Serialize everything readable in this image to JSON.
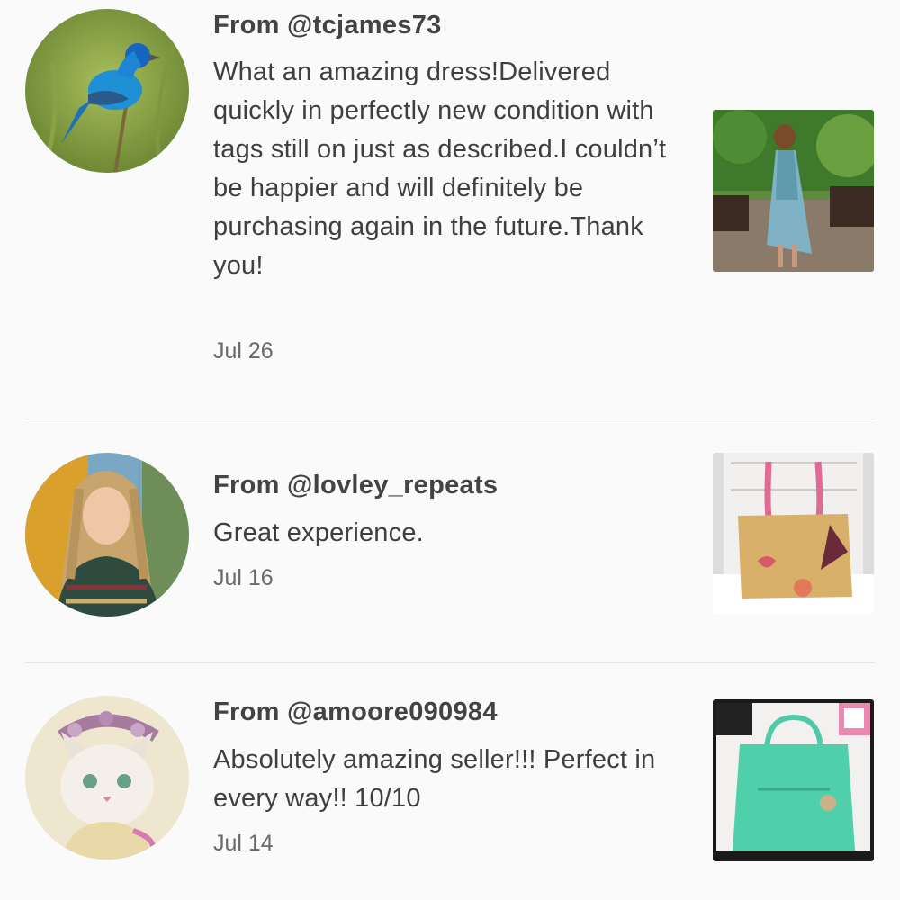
{
  "reviews": [
    {
      "from": "From @tcjames73",
      "text": "What an amazing dress!Delivered quickly in perfectly new condition with tags still on just as described.I couldn’t be happier and will definitely be purchasing again in the future.Thank you!",
      "date": "Jul 26",
      "avatar_icon": "bluebird-photo",
      "thumb_icon": "dress-photo"
    },
    {
      "from": "From @lovley_repeats",
      "text": "Great experience.",
      "date": "Jul 16",
      "avatar_icon": "woman-portrait-photo",
      "thumb_icon": "handbag-photo"
    },
    {
      "from": "From @amoore090984",
      "text": "Absolutely amazing seller!!! Perfect in every way!! 10/10",
      "date": "Jul 14",
      "avatar_icon": "kitten-illustration",
      "thumb_icon": "teal-tote-photo"
    }
  ]
}
